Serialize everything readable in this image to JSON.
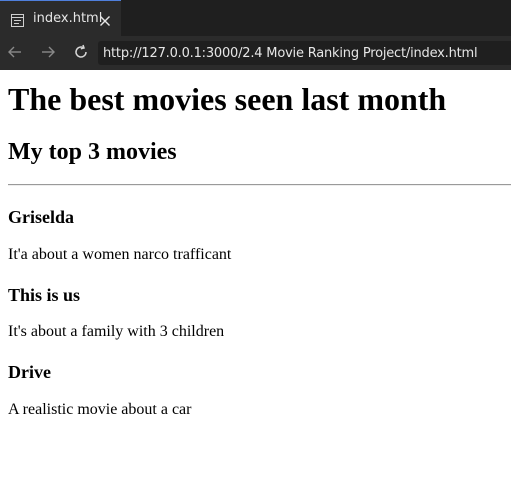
{
  "browser": {
    "tab_title": "index.html",
    "url": "http://127.0.0.1:3000/2.4 Movie Ranking Project/index.html",
    "icons": {
      "tab": "page-icon",
      "close": "close-icon",
      "back": "arrow-left-icon",
      "forward": "arrow-right-icon",
      "reload": "reload-icon"
    },
    "colors": {
      "chrome_bg": "#1f1f1f",
      "active_tab_bg": "#2b2b2b",
      "tab_accent": "#4f7fdc",
      "text": "#e6e6e6"
    }
  },
  "page": {
    "title": "The best movies seen last month",
    "subtitle": "My top 3 movies",
    "movies": [
      {
        "name": "Griselda",
        "description": "It'a about a women narco trafficant"
      },
      {
        "name": "This is us",
        "description": "It's about a family with 3 children"
      },
      {
        "name": "Drive",
        "description": "A realistic movie about a car"
      }
    ]
  }
}
